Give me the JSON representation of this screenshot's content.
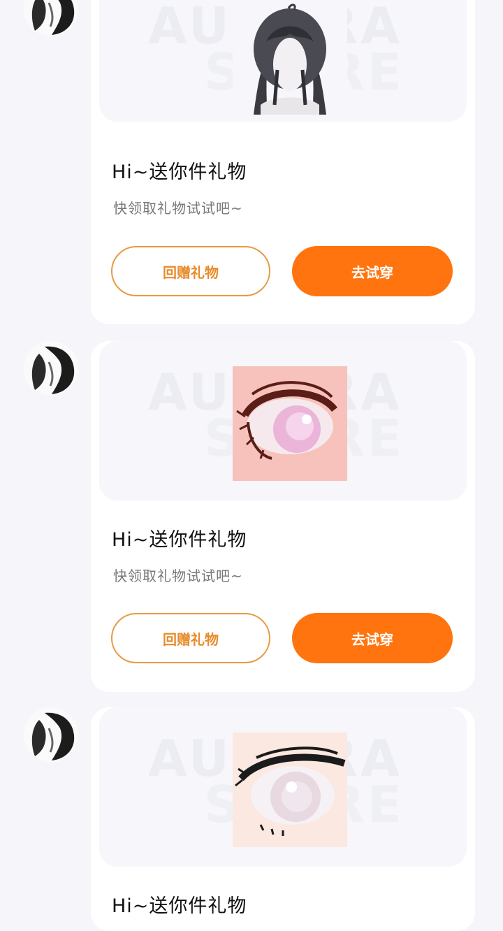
{
  "messages": [
    {
      "title": "Hi~送你件礼物",
      "subtitle": "快领取礼物试试吧~",
      "return_label": "回赠礼物",
      "try_label": "去试穿",
      "item_icon": "hair-icon"
    },
    {
      "title": "Hi~送你件礼物",
      "subtitle": "快领取礼物试试吧~",
      "return_label": "回赠礼物",
      "try_label": "去试穿",
      "item_icon": "eye-pink-icon"
    },
    {
      "title": "Hi~送你件礼物",
      "item_icon": "eye-light-icon"
    }
  ],
  "colors": {
    "accent": "#ff740e",
    "outline": "#e79a44",
    "background": "#f5f5fa"
  },
  "watermark_icon": "watermark-logo-icon"
}
